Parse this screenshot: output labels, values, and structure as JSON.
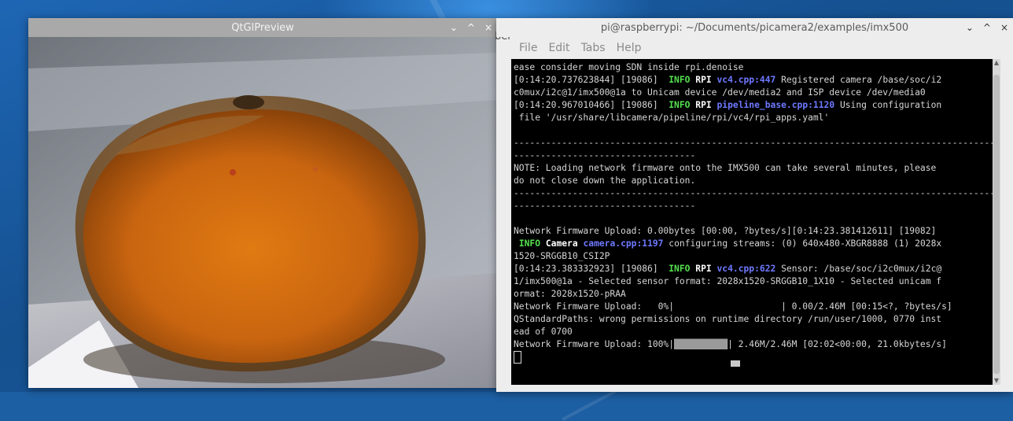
{
  "preview_window": {
    "title": "QtGlPreview",
    "controls": [
      "⌄",
      "^",
      "×"
    ]
  },
  "terminal_window": {
    "title": "pi@raspberrypi: ~/Documents/picamera2/examples/imx500",
    "controls": [
      "⌄",
      "^",
      "×"
    ],
    "side_fragment": "ber",
    "menu": [
      "File",
      "Edit",
      "Tabs",
      "Help"
    ],
    "lines": [
      [
        {
          "t": "ease consider moving SDN inside rpi.denoise"
        }
      ],
      [
        {
          "t": "[0:14:20.737623844] [19086]  "
        },
        {
          "t": "INFO",
          "c": "t-info"
        },
        {
          "t": " "
        },
        {
          "t": "RPI",
          "c": "t-rpi"
        },
        {
          "t": " "
        },
        {
          "t": "vc4.cpp:447",
          "c": "t-src"
        },
        {
          "t": " Registered camera /base/soc/i2"
        }
      ],
      [
        {
          "t": "c0mux/i2c@1/imx500@1a to Unicam device /dev/media2 and ISP device /dev/media0"
        }
      ],
      [
        {
          "t": "[0:14:20.967010466] [19086]  "
        },
        {
          "t": "INFO",
          "c": "t-info"
        },
        {
          "t": " "
        },
        {
          "t": "RPI",
          "c": "t-rpi"
        },
        {
          "t": " "
        },
        {
          "t": "pipeline_base.cpp:1120",
          "c": "t-src"
        },
        {
          "t": " Using configuration"
        }
      ],
      [
        {
          "t": " file '/usr/share/libcamera/pipeline/rpi/vc4/rpi_apps.yaml'"
        }
      ],
      [
        {
          "t": ""
        }
      ],
      [
        {
          "t": "------------------------------------------------------------------------------------------"
        }
      ],
      [
        {
          "t": "----------------------------------"
        }
      ],
      [
        {
          "t": "NOTE: Loading network firmware onto the IMX500 can take several minutes, please"
        }
      ],
      [
        {
          "t": "do not close down the application."
        }
      ],
      [
        {
          "t": "------------------------------------------------------------------------------------------"
        }
      ],
      [
        {
          "t": "----------------------------------"
        }
      ],
      [
        {
          "t": ""
        }
      ],
      [
        {
          "t": "Network Firmware Upload: 0.00bytes [00:00, ?bytes/s][0:14:23.381412611] [19082]"
        }
      ],
      [
        {
          "t": " "
        },
        {
          "t": "INFO",
          "c": "t-info"
        },
        {
          "t": " "
        },
        {
          "t": "Camera",
          "c": "t-rpi"
        },
        {
          "t": " "
        },
        {
          "t": "camera.cpp:1197",
          "c": "t-src"
        },
        {
          "t": " configuring streams: (0) 640x480-XBGR8888 (1) 2028x"
        }
      ],
      [
        {
          "t": "1520-SRGGB10_CSI2P"
        }
      ],
      [
        {
          "t": "[0:14:23.383332923] [19086]  "
        },
        {
          "t": "INFO",
          "c": "t-info"
        },
        {
          "t": " "
        },
        {
          "t": "RPI",
          "c": "t-rpi"
        },
        {
          "t": " "
        },
        {
          "t": "vc4.cpp:622",
          "c": "t-src"
        },
        {
          "t": " Sensor: /base/soc/i2c0mux/i2c@"
        }
      ],
      [
        {
          "t": "1/imx500@1a - Selected sensor format: 2028x1520-SRGGB10_1X10 - Selected unicam f"
        }
      ],
      [
        {
          "t": "ormat: 2028x1520-pRAA"
        }
      ],
      [
        {
          "t": "Network Firmware Upload:   0%|                    | 0.00/2.46M [00:15<?, ?bytes/s]"
        }
      ],
      [
        {
          "t": "QStandardPaths: wrong permissions on runtime directory /run/user/1000, 0770 inst"
        }
      ],
      [
        {
          "t": "ead of 0700"
        }
      ],
      [
        {
          "t": "Network Firmware Upload: 100%|"
        },
        {
          "t": "██████████",
          "c": "t-bar"
        },
        {
          "t": "| 2.46M/2.46M [02:02<00:00, 21.0kbytes/s]"
        }
      ]
    ]
  },
  "colors": {
    "desktop_bg": "#1d5fa3",
    "terminal_bg": "#000000",
    "info_green": "#54e04f",
    "source_blue": "#6e79ff"
  }
}
